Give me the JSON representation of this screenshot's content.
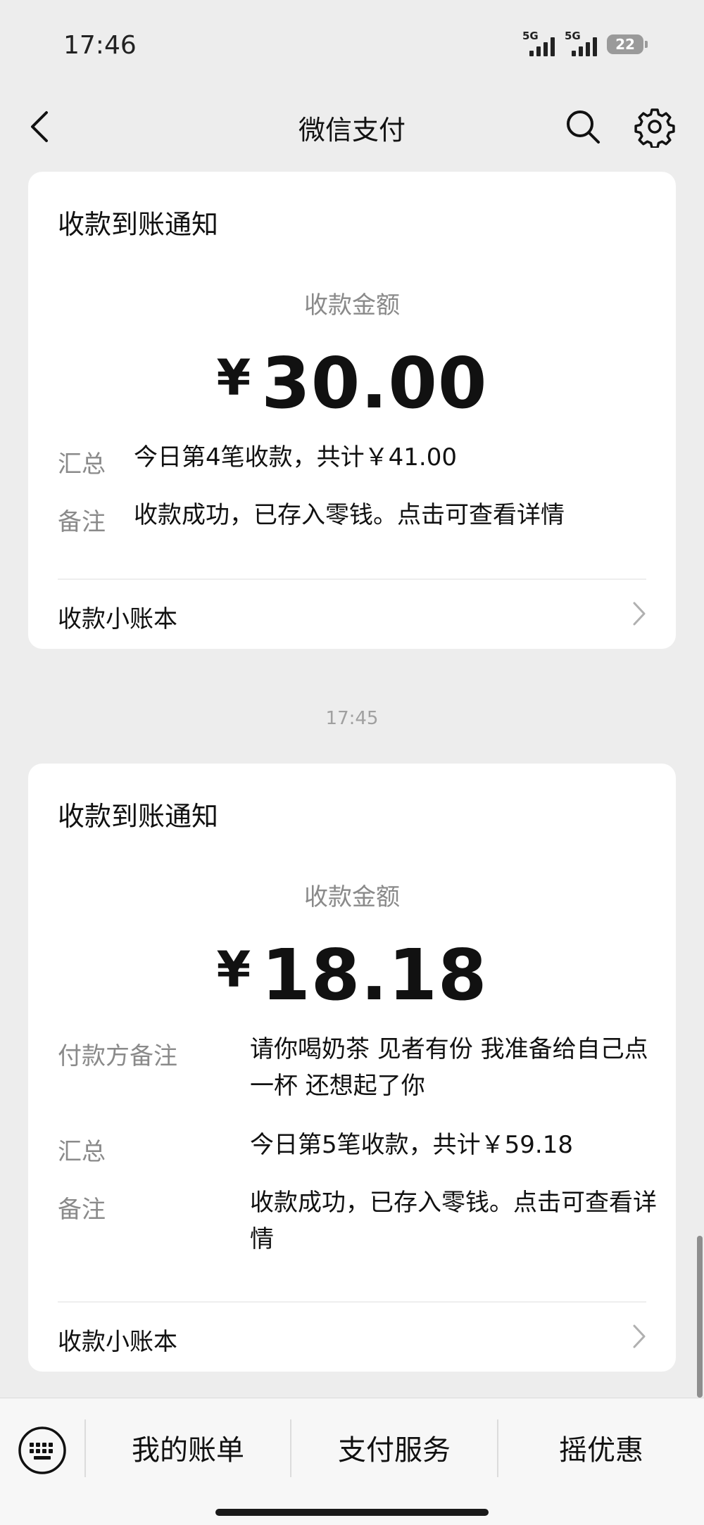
{
  "status_bar": {
    "time": "17:46",
    "signal1_label": "5G",
    "signal2_label": "5G",
    "battery": "22"
  },
  "nav": {
    "title": "微信支付",
    "back_icon": "back-arrow-icon",
    "search_icon": "search-icon",
    "settings_icon": "gear-icon"
  },
  "cards": [
    {
      "title": "收款到账通知",
      "amount_label": "收款金额",
      "currency": "¥",
      "amount": "30.00",
      "summary_label": "汇总",
      "summary_value": "今日第4笔收款，共计￥41.00",
      "note_label": "备注",
      "note_value": "收款成功，已存入零钱。点击可查看详情",
      "ledger_label": "收款小账本"
    },
    {
      "title": "收款到账通知",
      "amount_label": "收款金额",
      "currency": "¥",
      "amount": "18.18",
      "payer_note_label": "付款方备注",
      "payer_note_value": "请你喝奶茶 见者有份 我准备给自己点一杯 还想起了你",
      "summary_label": "汇总",
      "summary_value": "今日第5笔收款，共计￥59.18",
      "note_label": "备注",
      "note_value": "收款成功，已存入零钱。点击可查看详情",
      "ledger_label": "收款小账本"
    }
  ],
  "timestamp": "17:45",
  "bottom_bar": {
    "keyboard_icon": "keyboard-icon",
    "tabs": [
      {
        "label": "我的账单"
      },
      {
        "label": "支付服务"
      },
      {
        "label": "摇优惠"
      }
    ]
  }
}
